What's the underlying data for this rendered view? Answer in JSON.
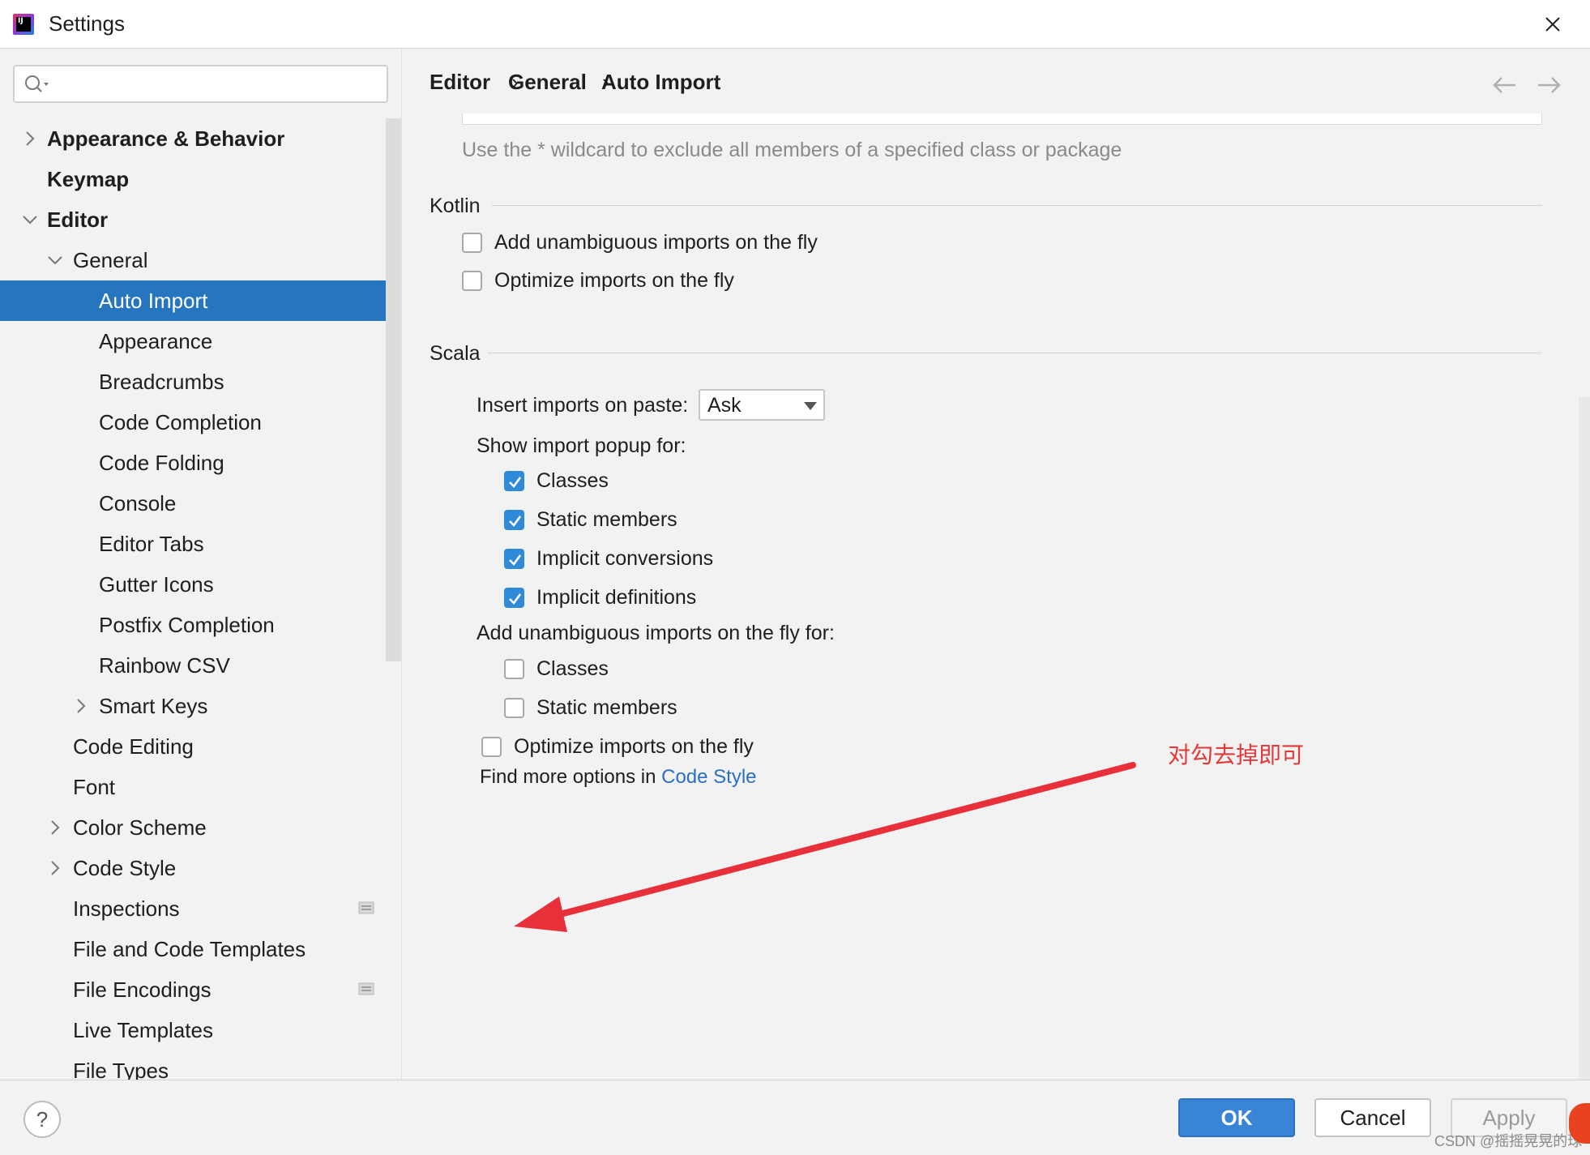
{
  "window": {
    "title": "Settings",
    "app_icon_text": "IJ"
  },
  "search": {
    "value": "",
    "placeholder": ""
  },
  "sidebar": {
    "items": [
      {
        "label": "Appearance & Behavior",
        "level": 0,
        "expandable": true,
        "expanded": false,
        "bold": true
      },
      {
        "label": "Keymap",
        "level": 0,
        "expandable": false,
        "bold": true
      },
      {
        "label": "Editor",
        "level": 0,
        "expandable": true,
        "expanded": true,
        "bold": true
      },
      {
        "label": "General",
        "level": 1,
        "expandable": true,
        "expanded": true
      },
      {
        "label": "Auto Import",
        "level": 2,
        "selected": true
      },
      {
        "label": "Appearance",
        "level": 2
      },
      {
        "label": "Breadcrumbs",
        "level": 2
      },
      {
        "label": "Code Completion",
        "level": 2
      },
      {
        "label": "Code Folding",
        "level": 2
      },
      {
        "label": "Console",
        "level": 2
      },
      {
        "label": "Editor Tabs",
        "level": 2
      },
      {
        "label": "Gutter Icons",
        "level": 2
      },
      {
        "label": "Postfix Completion",
        "level": 2
      },
      {
        "label": "Rainbow CSV",
        "level": 2
      },
      {
        "label": "Smart Keys",
        "level": 2,
        "expandable": true,
        "expanded": false
      },
      {
        "label": "Code Editing",
        "level": 1
      },
      {
        "label": "Font",
        "level": 1
      },
      {
        "label": "Color Scheme",
        "level": 1,
        "expandable": true,
        "expanded": false
      },
      {
        "label": "Code Style",
        "level": 1,
        "expandable": true,
        "expanded": false
      },
      {
        "label": "Inspections",
        "level": 1,
        "badge": true
      },
      {
        "label": "File and Code Templates",
        "level": 1
      },
      {
        "label": "File Encodings",
        "level": 1,
        "badge": true
      },
      {
        "label": "Live Templates",
        "level": 1
      },
      {
        "label": "File Types",
        "level": 1
      }
    ]
  },
  "breadcrumb": {
    "items": [
      "Editor",
      "General",
      "Auto Import"
    ],
    "separator": "›"
  },
  "content": {
    "hint": "Use the * wildcard to exclude all members of a specified class or package",
    "kotlin": {
      "title": "Kotlin",
      "options": [
        {
          "label": "Add unambiguous imports on the fly",
          "checked": false
        },
        {
          "label": "Optimize imports on the fly",
          "checked": false
        }
      ]
    },
    "scala": {
      "title": "Scala",
      "insert_label": "Insert imports on paste:",
      "insert_value": "Ask",
      "popup_label": "Show import popup for:",
      "popup_options": [
        {
          "label": "Classes",
          "checked": true
        },
        {
          "label": "Static members",
          "checked": true
        },
        {
          "label": "Implicit conversions",
          "checked": true
        },
        {
          "label": "Implicit definitions",
          "checked": true
        }
      ],
      "unambiguous_label": "Add unambiguous imports on the fly for:",
      "unambiguous_options": [
        {
          "label": "Classes",
          "checked": false
        },
        {
          "label": "Static members",
          "checked": false
        }
      ],
      "optimize": {
        "label": "Optimize imports on the fly",
        "checked": false
      },
      "more_prefix": "Find more options in",
      "more_link": "Code Style"
    }
  },
  "annotation": {
    "text": "对勾去掉即可",
    "color": "#e23a3a"
  },
  "footer": {
    "help": "?",
    "ok": "OK",
    "cancel": "Cancel",
    "apply": "Apply",
    "watermark": "CSDN @摇摇晃晃的球"
  },
  "colors": {
    "accent": "#2675bf",
    "checkbox_checked": "#2f8ad8",
    "link": "#2b6fc4"
  }
}
